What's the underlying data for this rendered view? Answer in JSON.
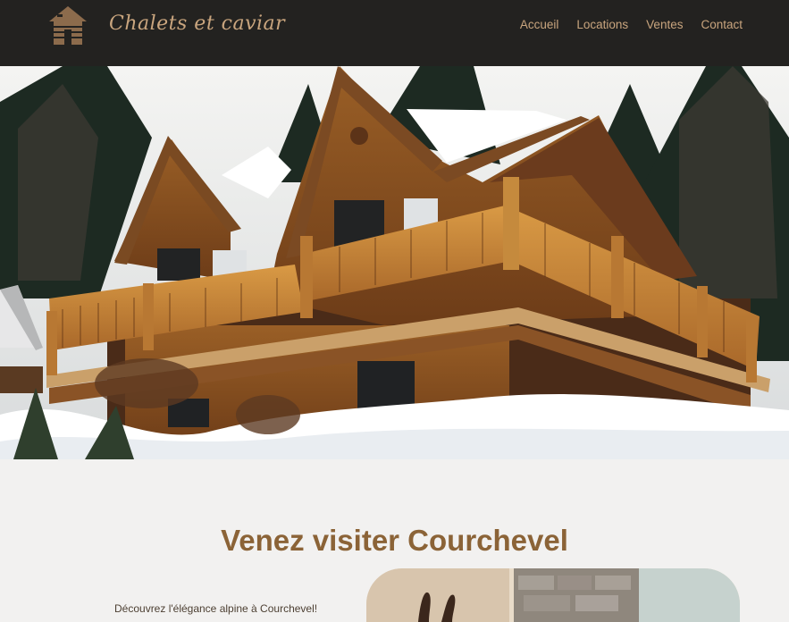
{
  "header": {
    "logo_text": "Chalets et caviar",
    "logo_icon": "log-cabin-icon",
    "nav": [
      {
        "label": "Accueil"
      },
      {
        "label": "Locations"
      },
      {
        "label": "Ventes"
      },
      {
        "label": "Contact"
      }
    ]
  },
  "hero": {
    "image": "snowy-wooden-chalet-photo"
  },
  "section": {
    "title": "Venez visiter Courchevel",
    "intro": "Découvrez l'élégance alpine à Courchevel!",
    "image": "chalet-detail-photo"
  },
  "colors": {
    "header_bg": "#232220",
    "accent": "#c9a57e",
    "title": "#8b6337",
    "page_bg": "#f2f1f0"
  }
}
